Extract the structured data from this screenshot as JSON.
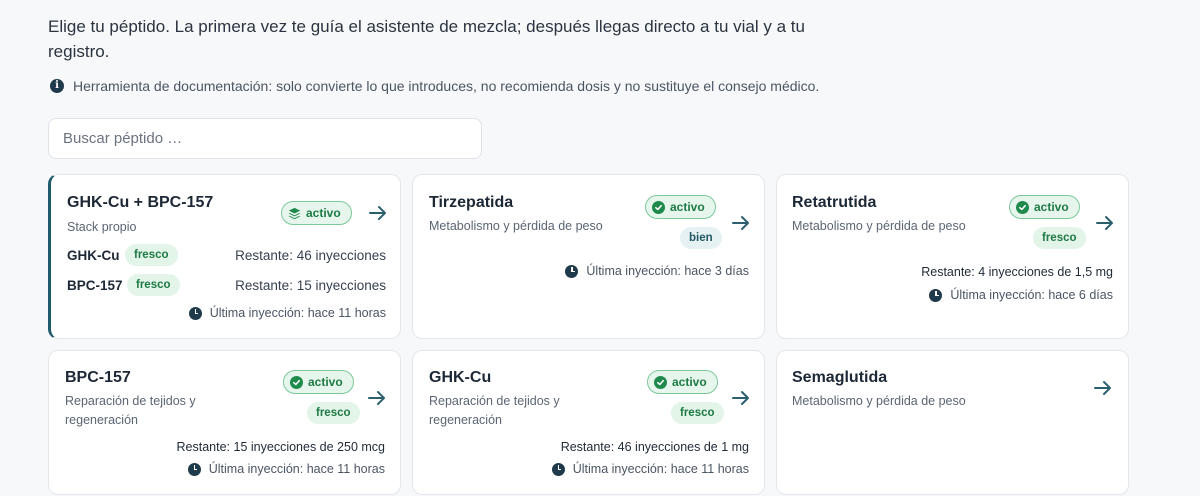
{
  "intro": "Elige tu péptido. La primera vez te guía el asistente de mezcla; después llegas directo a tu vial y a tu registro.",
  "disclaimer": "Herramienta de documentación: solo convierte lo que introduces, no recomienda dosis y no sustituye el consejo médico.",
  "search": {
    "placeholder": "Buscar péptido …"
  },
  "cards": [
    {
      "title": "GHK-Cu + BPC-157",
      "subtitle": "Stack propio",
      "badge": "activo",
      "rows": [
        {
          "name": "GHK-Cu",
          "status": "fresco",
          "remaining": "Restante: 46 inyecciones"
        },
        {
          "name": "BPC-157",
          "status": "fresco",
          "remaining": "Restante: 15 inyecciones"
        }
      ],
      "last": "Última inyección: hace 11 horas"
    },
    {
      "title": "Tirzepatida",
      "subtitle": "Metabolismo y pérdida de peso",
      "badge": "activo",
      "status": "bien",
      "last": "Última inyección: hace 3 días"
    },
    {
      "title": "Retatrutida",
      "subtitle": "Metabolismo y pérdida de peso",
      "badge": "activo",
      "status": "fresco",
      "remaining": "Restante: 4 inyecciones de 1,5 mg",
      "last": "Última inyección: hace 6 días"
    },
    {
      "title": "BPC-157",
      "subtitle": "Reparación de tejidos y regeneración",
      "badge": "activo",
      "status": "fresco",
      "remaining": "Restante: 15 inyecciones de 250 mcg",
      "last": "Última inyección: hace 11 horas"
    },
    {
      "title": "GHK-Cu",
      "subtitle": "Reparación de tejidos y regeneración",
      "badge": "activo",
      "status": "fresco",
      "remaining": "Restante: 46 inyecciones de 1 mg",
      "last": "Última inyección: hace 11 horas"
    },
    {
      "title": "Semaglutida",
      "subtitle": "Metabolismo y pérdida de peso"
    }
  ],
  "colors": {
    "accent": "#1e5a6a",
    "active_green": "#1f8a4c",
    "badge_bg": "#e6f6ec"
  }
}
